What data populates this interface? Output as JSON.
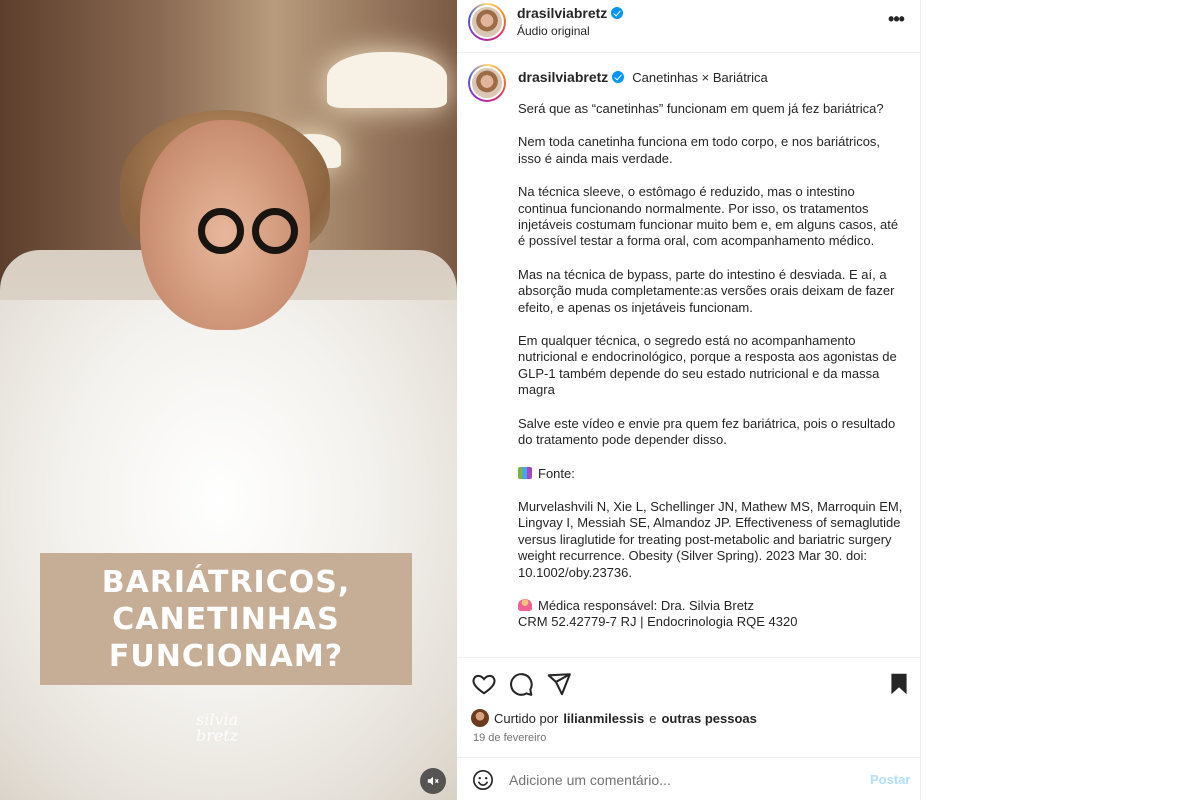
{
  "media": {
    "overlay_text": "BARIÁTRICOS,\nCANETINHAS\nFUNCIONAM?",
    "watermark": "silvia\nbretz",
    "mute_icon": "speaker-muted-icon"
  },
  "header": {
    "username": "drasilviabretz",
    "subtitle": "Áudio original",
    "more_icon": "more-options-icon",
    "more_label": "•••"
  },
  "caption": {
    "username": "drasilviabretz",
    "audio": "Canetinhas × Bariátrica",
    "paragraphs": [
      "Será que as “canetinhas” funcionam em quem já fez bariátrica?",
      "Nem toda canetinha funciona em todo corpo, e nos bariátricos, isso é ainda mais verdade.",
      "Na técnica sleeve, o estômago é reduzido, mas o intestino continua funcionando normalmente. Por isso, os tratamentos injetáveis costumam funcionar muito bem e, em alguns casos, até é possível testar a forma oral, com acompanhamento médico.",
      "Mas na técnica de bypass, parte do intestino é desviada. E aí, a absorção muda completamente:as versões orais deixam de fazer efeito, e apenas os injetáveis funcionam.",
      "Em qualquer técnica, o segredo está no acompanhamento nutricional e endocrinológico, porque a resposta aos agonistas de GLP-1 também depende do seu estado nutricional e da massa magra",
      "Salve este vídeo e envie pra quem fez bariátrica, pois o resultado do tratamento pode depender disso."
    ],
    "source_label": "Fonte:",
    "reference": "Murvelashvili N, Xie L, Schellinger JN, Mathew MS, Marroquin EM, Lingvay I, Messiah SE, Almandoz JP. Effectiveness of semaglutide versus liraglutide for treating post-metabolic and bariatric surgery weight recurrence. Obesity (Silver Spring). 2023 Mar 30. doi: 10.1002/oby.23736.",
    "responsible": "Médica responsável: Dra. Silvia Bretz",
    "crm": "CRM 52.42779-7 RJ | Endocrinologia RQE 4320"
  },
  "actions": {
    "like_icon": "heart-icon",
    "comment_icon": "comment-icon",
    "share_icon": "share-icon",
    "save_icon": "bookmark-icon",
    "liked_prefix": "Curtido por",
    "liked_user": "lilianmilessis",
    "liked_suffix": "e",
    "liked_others": "outras pessoas",
    "date": "19 de fevereiro"
  },
  "comment": {
    "emoji_icon": "emoji-icon",
    "placeholder": "Adicione um comentário...",
    "post_label": "Postar"
  },
  "colors": {
    "verified": "#0095f6",
    "post_button": "#b2dffc",
    "overlay_card": "#c6ae96"
  }
}
